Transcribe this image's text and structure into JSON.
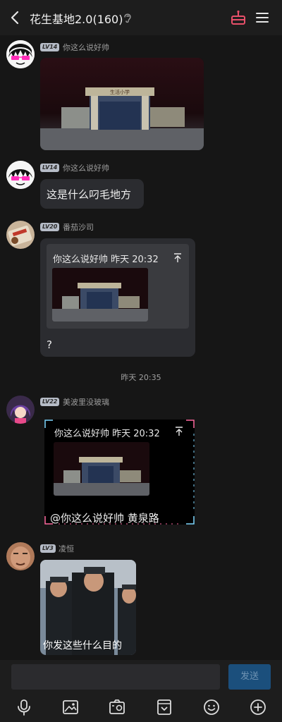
{
  "header": {
    "title": "花生基地2.0(160)"
  },
  "messages": [
    {
      "level": "LV14",
      "nick": "你这么说好帅"
    },
    {
      "level": "LV14",
      "nick": "你这么说好帅",
      "text": "这是什么叼毛地方"
    },
    {
      "level": "LV20",
      "nick": "番茄沙司",
      "quote_header": "你这么说好帅 昨天 20:32",
      "text": "?"
    },
    {
      "level": "LV22",
      "nick": "美波里没玻璃",
      "quote_header": "你这么说好帅 昨天 20:32",
      "text": "@你这么说好帅 黄泉路"
    },
    {
      "level": "LV3",
      "nick": "凌恒",
      "caption": "你发这些什么目的"
    }
  ],
  "time_separator": "昨天 20:35",
  "composer": {
    "send_label": "发送"
  },
  "photo_sign": "生活小学",
  "colors": {
    "send_bg": "#1b4f7c",
    "frame_accent": "#7fd8ff",
    "frame_accent2": "#ff6aa0",
    "cake_icon": "#e8506a"
  },
  "icons": [
    "back-arrow-icon",
    "ear-icon",
    "gift-cake-icon",
    "menu-icon",
    "microphone-icon",
    "image-icon",
    "camera-icon",
    "sticker-icon",
    "emoji-icon",
    "plus-icon",
    "pin-top-icon"
  ]
}
